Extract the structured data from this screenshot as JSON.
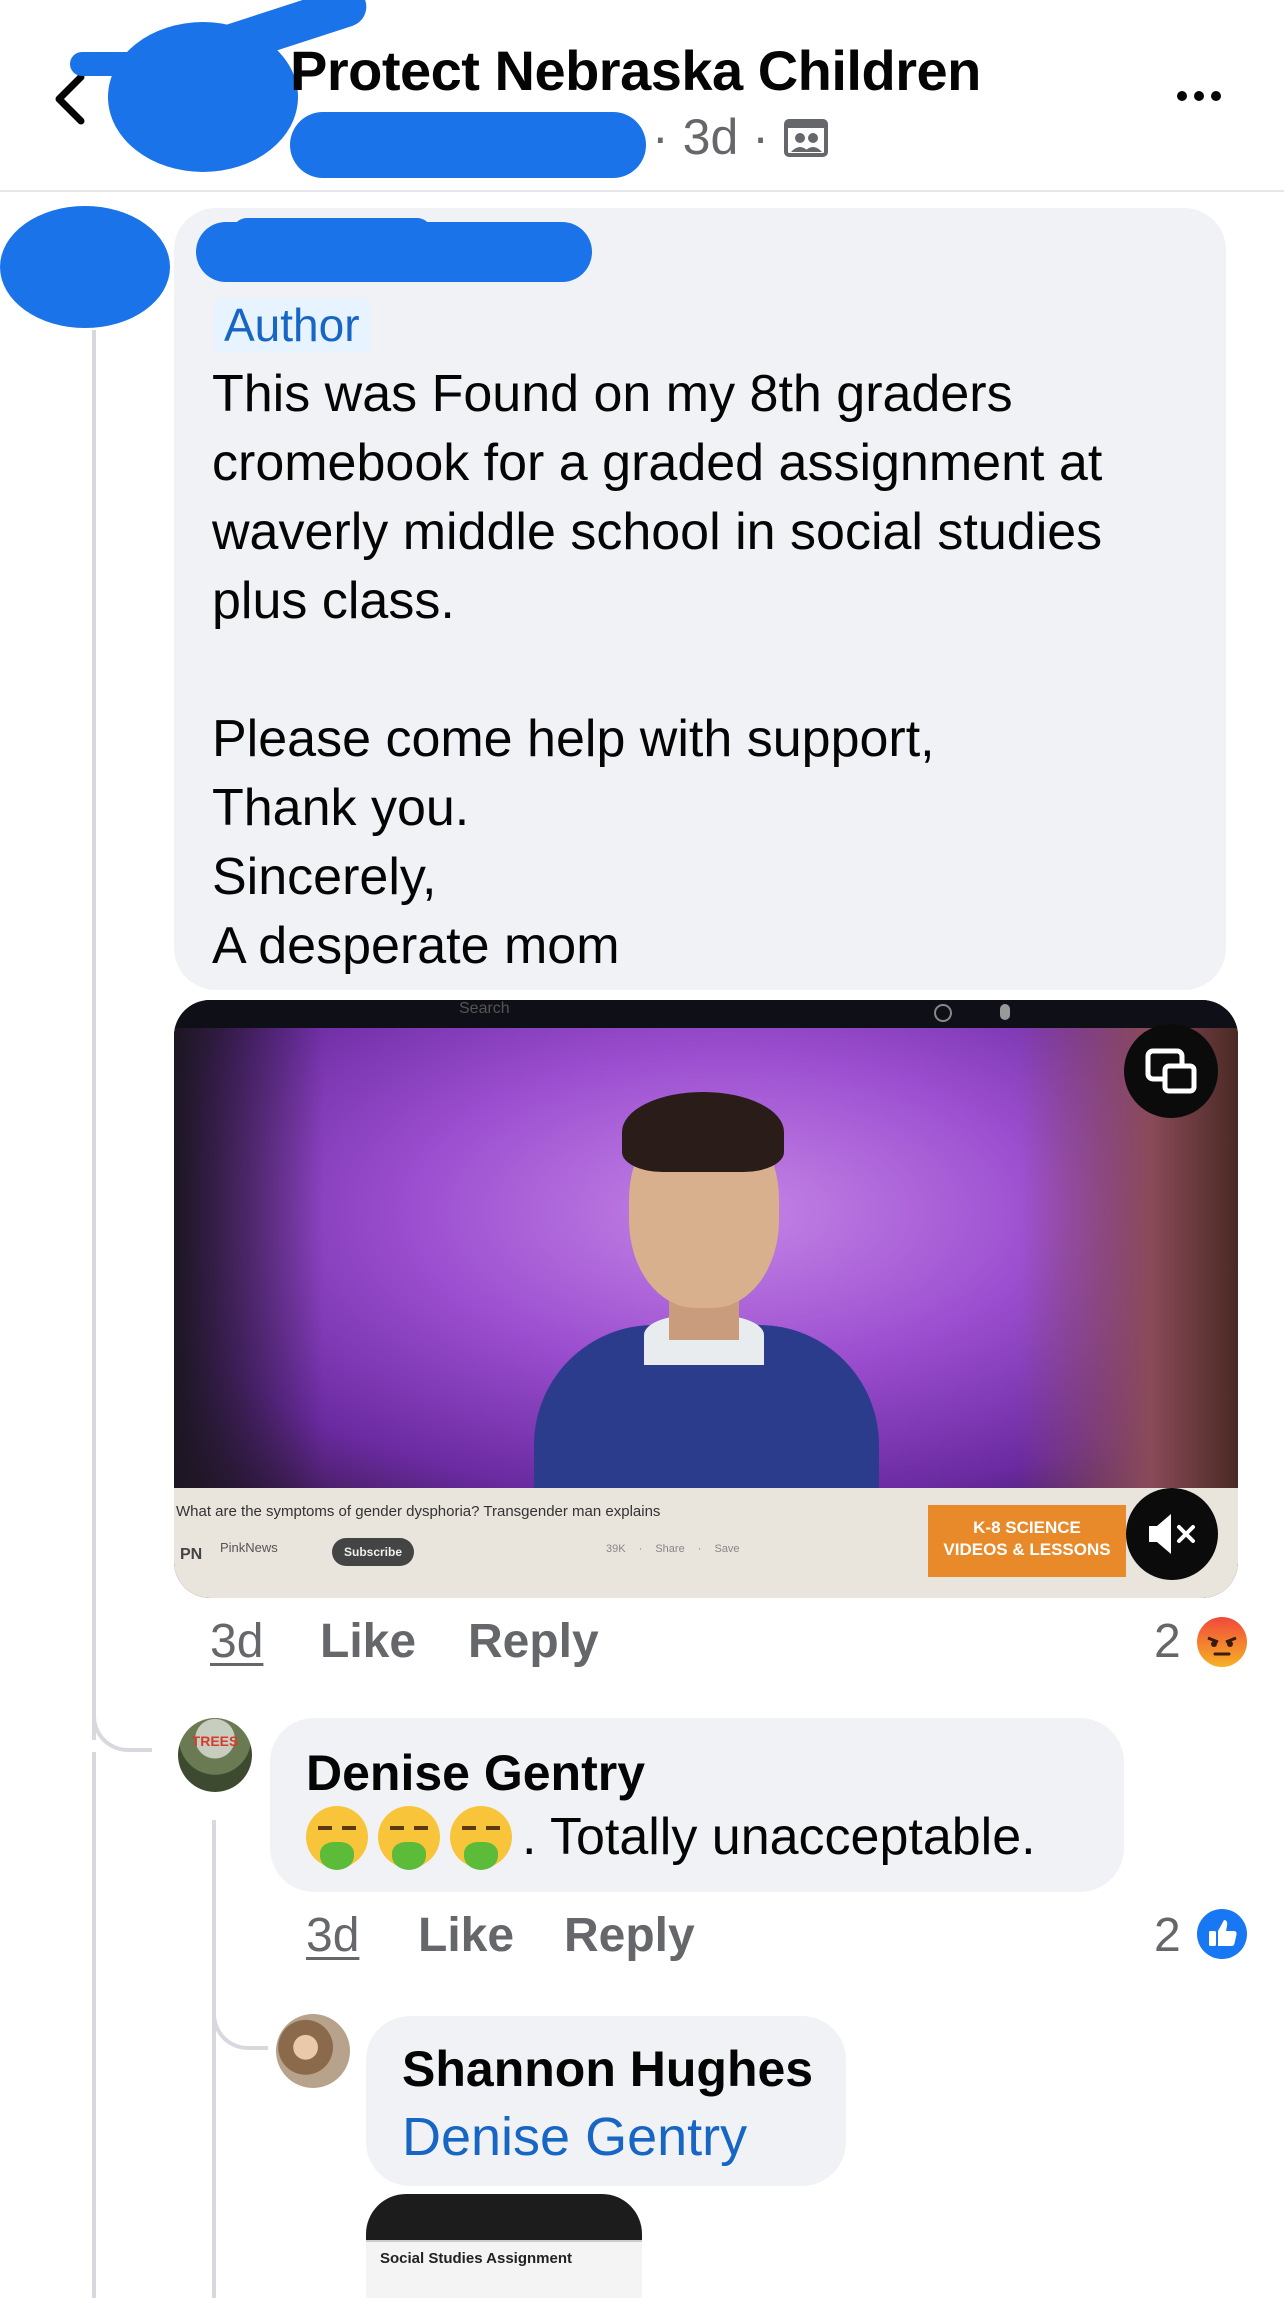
{
  "header": {
    "title": "Protect Nebraska Children",
    "age": "3d",
    "separator": "·"
  },
  "main_comment": {
    "badge": "Author",
    "text": "This was Found on my 8th graders\ncromebook for a graded assignment at\nwaverly middle school in social studies\nplus class.\n\nPlease come help with support,\nThank you.\nSincerely,\nA desperate mom",
    "video": {
      "search_placeholder": "Search",
      "caption": "What are the symptoms of gender dysphoria? Transgender man explains",
      "channel": "PinkNews",
      "channel_logo": "PN",
      "subscribe_label": "Subscribe",
      "meta": "39K · Share · Save",
      "ad_line1": "K-8 SCIENCE",
      "ad_line2": "VIDEOS & LESSONS"
    },
    "actions": {
      "time": "3d",
      "like": "Like",
      "reply": "Reply"
    },
    "reaction_count": "2",
    "reaction_type": "angry"
  },
  "reply1": {
    "name": "Denise Gentry",
    "avatar_text": "TREES",
    "text": ". Totally unacceptable.",
    "emoji": "nauseated-vomit",
    "actions": {
      "time": "3d",
      "like": "Like",
      "reply": "Reply"
    },
    "reaction_count": "2",
    "reaction_type": "like"
  },
  "reply2": {
    "name": "Shannon Hughes",
    "mention": "Denise Gentry",
    "attachment_title": "Social Studies Assignment"
  },
  "colors": {
    "link_blue": "#1766c4",
    "bubble_bg": "#f0f2f5",
    "muted_text": "#65676b",
    "redaction": "#1a73e8",
    "angry_reaction": "#f25c2a",
    "like_reaction": "#1877f2"
  }
}
